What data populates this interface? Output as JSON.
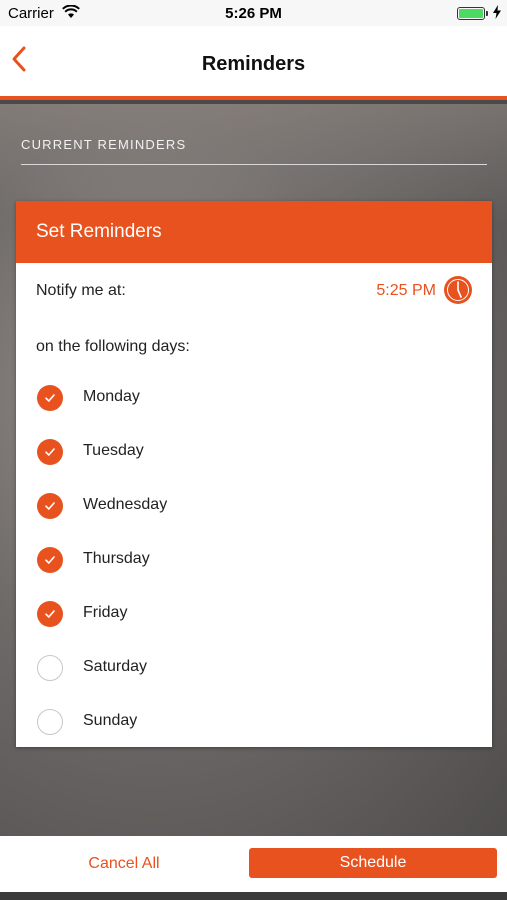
{
  "status_bar": {
    "carrier": "Carrier",
    "time": "5:26 PM"
  },
  "nav": {
    "title": "Reminders",
    "back_icon": "chevron-left-icon"
  },
  "section": {
    "current_label": "CURRENT REMINDERS"
  },
  "card": {
    "title": "Set Reminders",
    "notify_label": "Notify me at:",
    "notify_time": "5:25 PM",
    "clock_icon": "clock-icon",
    "days_label": "on the following days:",
    "days": [
      {
        "label": "Monday",
        "checked": true
      },
      {
        "label": "Tuesday",
        "checked": true
      },
      {
        "label": "Wednesday",
        "checked": true
      },
      {
        "label": "Thursday",
        "checked": true
      },
      {
        "label": "Friday",
        "checked": true
      },
      {
        "label": "Saturday",
        "checked": false
      },
      {
        "label": "Sunday",
        "checked": false
      }
    ]
  },
  "footer": {
    "cancel_label": "Cancel All",
    "schedule_label": "Schedule"
  },
  "colors": {
    "accent": "#e8521e",
    "unchecked_border": "#c8c8c8"
  }
}
